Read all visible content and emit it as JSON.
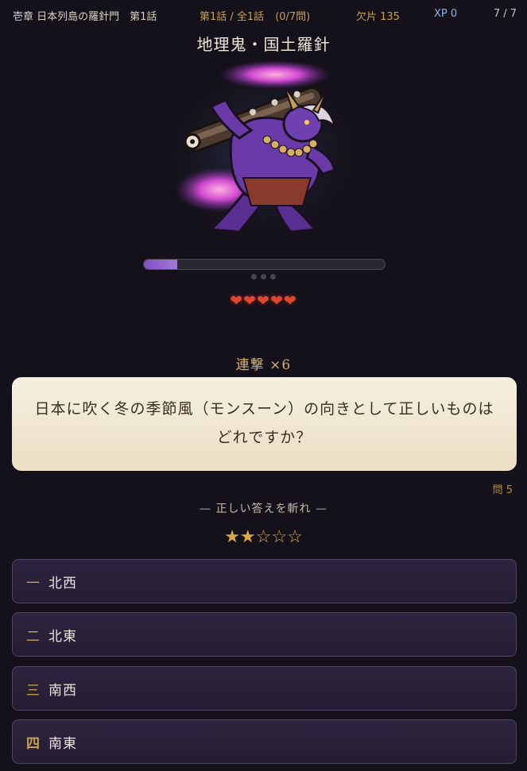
{
  "header": {
    "chapter": "壱章 日本列島の羅針門　第1話",
    "episode": "第1話 / 全1話",
    "progress": "(0/7問)",
    "fragments": "欠片 135",
    "xp": "XP 0",
    "page": "7 / 7"
  },
  "enemy": {
    "name": "地理鬼・国土羅針",
    "hp_fraction": 0.14,
    "dots": 3
  },
  "player": {
    "hearts": "❤❤❤❤❤",
    "hearts_count": 5
  },
  "combo": "連撃 ×6",
  "question": {
    "text": "日本に吹く冬の季節風（モンスーン）の向きとして正しいものはどれですか？",
    "number": "問 5"
  },
  "instruction": "— 正しい答えを斬れ —",
  "difficulty": {
    "stars": "★★☆☆☆",
    "filled": 2,
    "total": 5
  },
  "answers": [
    {
      "num": "一",
      "label": "北西"
    },
    {
      "num": "二",
      "label": "北東"
    },
    {
      "num": "三",
      "label": "南西"
    },
    {
      "num": "四",
      "label": "南東"
    }
  ],
  "colors": {
    "background": "#15111a",
    "gold": "#c9a24f",
    "xp_blue": "#8ab4e8",
    "hp_purple": "#8a5ccc",
    "heart_red": "#e0452e",
    "card_cream": "#f3ead8"
  }
}
